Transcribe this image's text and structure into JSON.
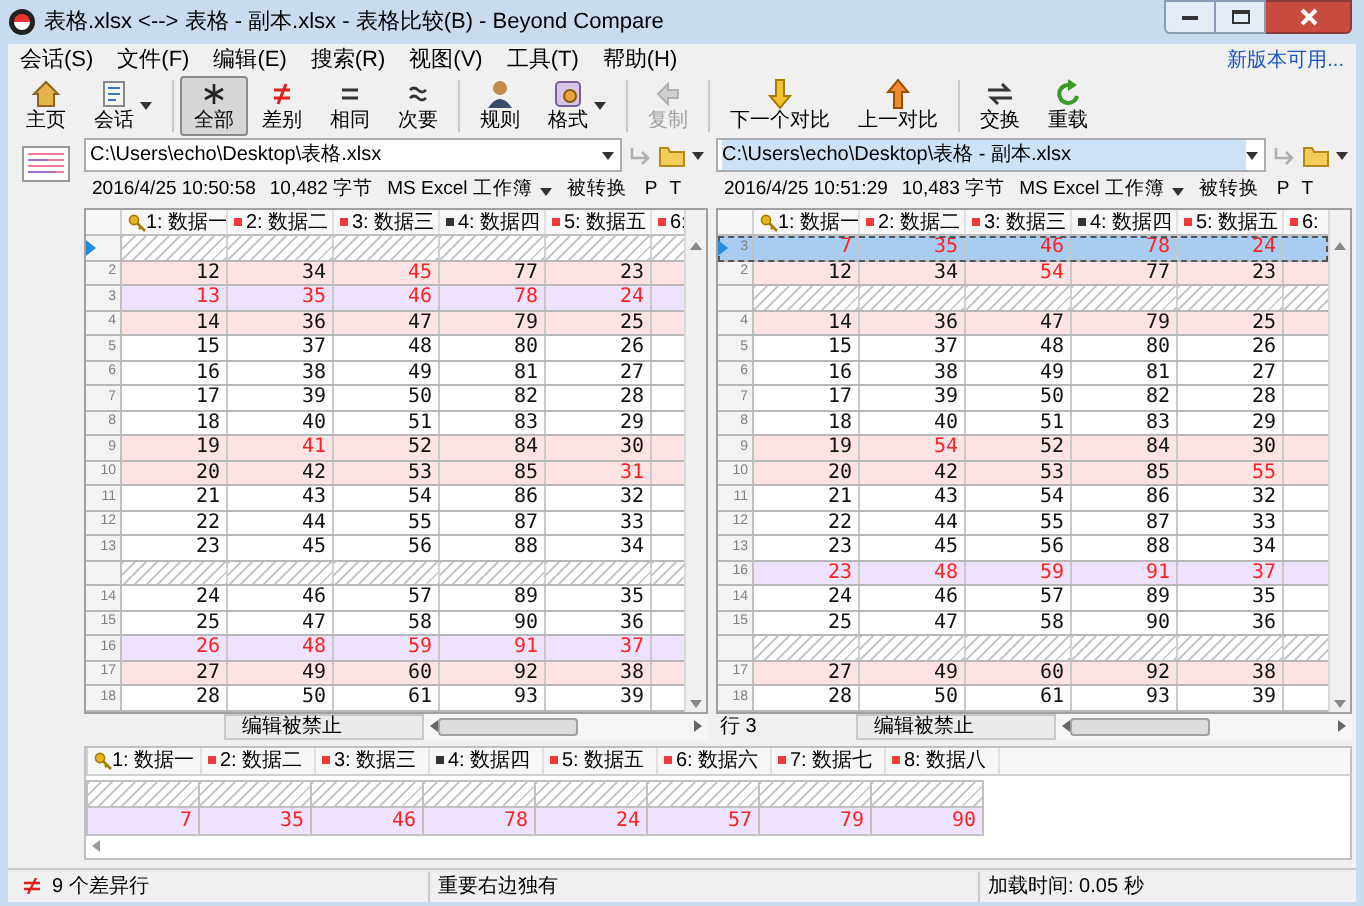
{
  "window": {
    "title": "表格.xlsx <--> 表格 - 副本.xlsx - 表格比较(B) - Beyond Compare"
  },
  "menu": [
    "会话(S)",
    "文件(F)",
    "编辑(E)",
    "搜索(R)",
    "视图(V)",
    "工具(T)",
    "帮助(H)"
  ],
  "update_link": "新版本可用...",
  "toolbar": [
    [
      {
        "label": "主页",
        "kind": "home",
        "selected": false,
        "disabled": false,
        "dropdown": false
      },
      {
        "label": "会话",
        "kind": "session",
        "selected": false,
        "disabled": false,
        "dropdown": true
      }
    ],
    [
      {
        "label": "全部",
        "kind": "all",
        "selected": true,
        "disabled": false,
        "dropdown": false
      },
      {
        "label": "差别",
        "kind": "diffs",
        "selected": false,
        "disabled": false,
        "dropdown": false
      },
      {
        "label": "相同",
        "kind": "same",
        "selected": false,
        "disabled": false,
        "dropdown": false
      },
      {
        "label": "次要",
        "kind": "minor",
        "selected": false,
        "disabled": false,
        "dropdown": false
      }
    ],
    [
      {
        "label": "规则",
        "kind": "rules",
        "selected": false,
        "disabled": false,
        "dropdown": false
      },
      {
        "label": "格式",
        "kind": "format",
        "selected": false,
        "disabled": false,
        "dropdown": true
      }
    ],
    [
      {
        "label": "复制",
        "kind": "copy",
        "selected": false,
        "disabled": true,
        "dropdown": false
      }
    ],
    [
      {
        "label": "下一个对比",
        "kind": "next",
        "selected": false,
        "disabled": false,
        "dropdown": false
      },
      {
        "label": "上一对比",
        "kind": "prev",
        "selected": false,
        "disabled": false,
        "dropdown": false
      }
    ],
    [
      {
        "label": "交换",
        "kind": "swap",
        "selected": false,
        "disabled": false,
        "dropdown": false
      },
      {
        "label": "重载",
        "kind": "reload",
        "selected": false,
        "disabled": false,
        "dropdown": false
      }
    ]
  ],
  "panes": [
    {
      "path": "C:\\Users\\echo\\Desktop\\表格.xlsx",
      "path_selected": false,
      "modified": "2016/4/25 10:50:58",
      "size": "10,482 字节",
      "format": "MS Excel 工作簿",
      "converted": "被转换",
      "flags": [
        "P",
        "T"
      ],
      "columns": [
        {
          "label": "1: 数据一",
          "kind": "key"
        },
        {
          "label": "2: 数据二",
          "kind": "red"
        },
        {
          "label": "3: 数据三",
          "kind": "red"
        },
        {
          "label": "4: 数据四",
          "kind": "black"
        },
        {
          "label": "5: 数据五",
          "kind": "red"
        },
        {
          "label": "6:",
          "kind": "red"
        }
      ],
      "rows": [
        {
          "kind": "gap",
          "current": true
        },
        {
          "kind": "diff",
          "number": "2",
          "selected": false,
          "current": false,
          "cells": [
            {
              "text": "12",
              "diff": false
            },
            {
              "text": "34",
              "diff": false
            },
            {
              "text": "45",
              "diff": true
            },
            {
              "text": "77",
              "diff": false
            },
            {
              "text": "23",
              "diff": false
            }
          ]
        },
        {
          "kind": "orphan",
          "number": "3",
          "selected": false,
          "current": false,
          "cells": [
            {
              "text": "13",
              "diff": true
            },
            {
              "text": "35",
              "diff": true
            },
            {
              "text": "46",
              "diff": true
            },
            {
              "text": "78",
              "diff": true
            },
            {
              "text": "24",
              "diff": true
            }
          ]
        },
        {
          "kind": "diff",
          "number": "4",
          "selected": false,
          "current": false,
          "cells": [
            {
              "text": "14",
              "diff": false
            },
            {
              "text": "36",
              "diff": false
            },
            {
              "text": "47",
              "diff": false
            },
            {
              "text": "79",
              "diff": false
            },
            {
              "text": "25",
              "diff": false
            }
          ]
        },
        {
          "kind": "same",
          "number": "5",
          "selected": false,
          "current": false,
          "cells": [
            {
              "text": "15",
              "diff": false
            },
            {
              "text": "37",
              "diff": false
            },
            {
              "text": "48",
              "diff": false
            },
            {
              "text": "80",
              "diff": false
            },
            {
              "text": "26",
              "diff": false
            }
          ]
        },
        {
          "kind": "same",
          "number": "6",
          "selected": false,
          "current": false,
          "cells": [
            {
              "text": "16",
              "diff": false
            },
            {
              "text": "38",
              "diff": false
            },
            {
              "text": "49",
              "diff": false
            },
            {
              "text": "81",
              "diff": false
            },
            {
              "text": "27",
              "diff": false
            }
          ]
        },
        {
          "kind": "same",
          "number": "7",
          "selected": false,
          "current": false,
          "cells": [
            {
              "text": "17",
              "diff": false
            },
            {
              "text": "39",
              "diff": false
            },
            {
              "text": "50",
              "diff": false
            },
            {
              "text": "82",
              "diff": false
            },
            {
              "text": "28",
              "diff": false
            }
          ]
        },
        {
          "kind": "same",
          "number": "8",
          "selected": false,
          "current": false,
          "cells": [
            {
              "text": "18",
              "diff": false
            },
            {
              "text": "40",
              "diff": false
            },
            {
              "text": "51",
              "diff": false
            },
            {
              "text": "83",
              "diff": false
            },
            {
              "text": "29",
              "diff": false
            }
          ]
        },
        {
          "kind": "diff",
          "number": "9",
          "selected": false,
          "current": false,
          "cells": [
            {
              "text": "19",
              "diff": false
            },
            {
              "text": "41",
              "diff": true
            },
            {
              "text": "52",
              "diff": false
            },
            {
              "text": "84",
              "diff": false
            },
            {
              "text": "30",
              "diff": false
            }
          ]
        },
        {
          "kind": "diff",
          "number": "10",
          "selected": false,
          "current": false,
          "cells": [
            {
              "text": "20",
              "diff": false
            },
            {
              "text": "42",
              "diff": false
            },
            {
              "text": "53",
              "diff": false
            },
            {
              "text": "85",
              "diff": false
            },
            {
              "text": "31",
              "diff": true
            }
          ]
        },
        {
          "kind": "same",
          "number": "11",
          "selected": false,
          "current": false,
          "cells": [
            {
              "text": "21",
              "diff": false
            },
            {
              "text": "43",
              "diff": false
            },
            {
              "text": "54",
              "diff": false
            },
            {
              "text": "86",
              "diff": false
            },
            {
              "text": "32",
              "diff": false
            }
          ]
        },
        {
          "kind": "same",
          "number": "12",
          "selected": false,
          "current": false,
          "cells": [
            {
              "text": "22",
              "diff": false
            },
            {
              "text": "44",
              "diff": false
            },
            {
              "text": "55",
              "diff": false
            },
            {
              "text": "87",
              "diff": false
            },
            {
              "text": "33",
              "diff": false
            }
          ]
        },
        {
          "kind": "same",
          "number": "13",
          "selected": false,
          "current": false,
          "cells": [
            {
              "text": "23",
              "diff": false
            },
            {
              "text": "45",
              "diff": false
            },
            {
              "text": "56",
              "diff": false
            },
            {
              "text": "88",
              "diff": false
            },
            {
              "text": "34",
              "diff": false
            }
          ]
        },
        {
          "kind": "gap",
          "current": false
        },
        {
          "kind": "same",
          "number": "14",
          "selected": false,
          "current": false,
          "cells": [
            {
              "text": "24",
              "diff": false
            },
            {
              "text": "46",
              "diff": false
            },
            {
              "text": "57",
              "diff": false
            },
            {
              "text": "89",
              "diff": false
            },
            {
              "text": "35",
              "diff": false
            }
          ]
        },
        {
          "kind": "same",
          "number": "15",
          "selected": false,
          "current": false,
          "cells": [
            {
              "text": "25",
              "diff": false
            },
            {
              "text": "47",
              "diff": false
            },
            {
              "text": "58",
              "diff": false
            },
            {
              "text": "90",
              "diff": false
            },
            {
              "text": "36",
              "diff": false
            }
          ]
        },
        {
          "kind": "orphan",
          "number": "16",
          "selected": false,
          "current": false,
          "cells": [
            {
              "text": "26",
              "diff": true
            },
            {
              "text": "48",
              "diff": true
            },
            {
              "text": "59",
              "diff": true
            },
            {
              "text": "91",
              "diff": true
            },
            {
              "text": "37",
              "diff": true
            }
          ]
        },
        {
          "kind": "diff",
          "number": "17",
          "selected": false,
          "current": false,
          "cells": [
            {
              "text": "27",
              "diff": false
            },
            {
              "text": "49",
              "diff": false
            },
            {
              "text": "60",
              "diff": false
            },
            {
              "text": "92",
              "diff": false
            },
            {
              "text": "38",
              "diff": false
            }
          ]
        },
        {
          "kind": "same",
          "number": "18",
          "selected": false,
          "current": false,
          "cells": [
            {
              "text": "28",
              "diff": false
            },
            {
              "text": "50",
              "diff": false
            },
            {
              "text": "61",
              "diff": false
            },
            {
              "text": "93",
              "diff": false
            },
            {
              "text": "39",
              "diff": false
            }
          ]
        }
      ],
      "edit_status": "编辑被禁止"
    },
    {
      "path": "C:\\Users\\echo\\Desktop\\表格 - 副本.xlsx",
      "path_selected": true,
      "modified": "2016/4/25 10:51:29",
      "size": "10,483 字节",
      "format": "MS Excel 工作簿",
      "converted": "被转换",
      "flags": [
        "P",
        "T"
      ],
      "columns": [
        {
          "label": "1: 数据一",
          "kind": "key"
        },
        {
          "label": "2: 数据二",
          "kind": "red"
        },
        {
          "label": "3: 数据三",
          "kind": "red"
        },
        {
          "label": "4: 数据四",
          "kind": "black"
        },
        {
          "label": "5: 数据五",
          "kind": "red"
        },
        {
          "label": "6:",
          "kind": "red"
        }
      ],
      "rows": [
        {
          "kind": "orphan",
          "number": "3",
          "selected": true,
          "current": true,
          "cells": [
            {
              "text": "7",
              "diff": true
            },
            {
              "text": "35",
              "diff": true
            },
            {
              "text": "46",
              "diff": true
            },
            {
              "text": "78",
              "diff": true
            },
            {
              "text": "24",
              "diff": true
            }
          ]
        },
        {
          "kind": "diff",
          "number": "2",
          "selected": false,
          "current": false,
          "cells": [
            {
              "text": "12",
              "diff": false
            },
            {
              "text": "34",
              "diff": false
            },
            {
              "text": "54",
              "diff": true
            },
            {
              "text": "77",
              "diff": false
            },
            {
              "text": "23",
              "diff": false
            }
          ]
        },
        {
          "kind": "gap",
          "current": false
        },
        {
          "kind": "diff",
          "number": "4",
          "selected": false,
          "current": false,
          "cells": [
            {
              "text": "14",
              "diff": false
            },
            {
              "text": "36",
              "diff": false
            },
            {
              "text": "47",
              "diff": false
            },
            {
              "text": "79",
              "diff": false
            },
            {
              "text": "25",
              "diff": false
            }
          ]
        },
        {
          "kind": "same",
          "number": "5",
          "selected": false,
          "current": false,
          "cells": [
            {
              "text": "15",
              "diff": false
            },
            {
              "text": "37",
              "diff": false
            },
            {
              "text": "48",
              "diff": false
            },
            {
              "text": "80",
              "diff": false
            },
            {
              "text": "26",
              "diff": false
            }
          ]
        },
        {
          "kind": "same",
          "number": "6",
          "selected": false,
          "current": false,
          "cells": [
            {
              "text": "16",
              "diff": false
            },
            {
              "text": "38",
              "diff": false
            },
            {
              "text": "49",
              "diff": false
            },
            {
              "text": "81",
              "diff": false
            },
            {
              "text": "27",
              "diff": false
            }
          ]
        },
        {
          "kind": "same",
          "number": "7",
          "selected": false,
          "current": false,
          "cells": [
            {
              "text": "17",
              "diff": false
            },
            {
              "text": "39",
              "diff": false
            },
            {
              "text": "50",
              "diff": false
            },
            {
              "text": "82",
              "diff": false
            },
            {
              "text": "28",
              "diff": false
            }
          ]
        },
        {
          "kind": "same",
          "number": "8",
          "selected": false,
          "current": false,
          "cells": [
            {
              "text": "18",
              "diff": false
            },
            {
              "text": "40",
              "diff": false
            },
            {
              "text": "51",
              "diff": false
            },
            {
              "text": "83",
              "diff": false
            },
            {
              "text": "29",
              "diff": false
            }
          ]
        },
        {
          "kind": "diff",
          "number": "9",
          "selected": false,
          "current": false,
          "cells": [
            {
              "text": "19",
              "diff": false
            },
            {
              "text": "54",
              "diff": true
            },
            {
              "text": "52",
              "diff": false
            },
            {
              "text": "84",
              "diff": false
            },
            {
              "text": "30",
              "diff": false
            }
          ]
        },
        {
          "kind": "diff",
          "number": "10",
          "selected": false,
          "current": false,
          "cells": [
            {
              "text": "20",
              "diff": false
            },
            {
              "text": "42",
              "diff": false
            },
            {
              "text": "53",
              "diff": false
            },
            {
              "text": "85",
              "diff": false
            },
            {
              "text": "55",
              "diff": true
            }
          ]
        },
        {
          "kind": "same",
          "number": "11",
          "selected": false,
          "current": false,
          "cells": [
            {
              "text": "21",
              "diff": false
            },
            {
              "text": "43",
              "diff": false
            },
            {
              "text": "54",
              "diff": false
            },
            {
              "text": "86",
              "diff": false
            },
            {
              "text": "32",
              "diff": false
            }
          ]
        },
        {
          "kind": "same",
          "number": "12",
          "selected": false,
          "current": false,
          "cells": [
            {
              "text": "22",
              "diff": false
            },
            {
              "text": "44",
              "diff": false
            },
            {
              "text": "55",
              "diff": false
            },
            {
              "text": "87",
              "diff": false
            },
            {
              "text": "33",
              "diff": false
            }
          ]
        },
        {
          "kind": "same",
          "number": "13",
          "selected": false,
          "current": false,
          "cells": [
            {
              "text": "23",
              "diff": false
            },
            {
              "text": "45",
              "diff": false
            },
            {
              "text": "56",
              "diff": false
            },
            {
              "text": "88",
              "diff": false
            },
            {
              "text": "34",
              "diff": false
            }
          ]
        },
        {
          "kind": "orphan",
          "number": "16",
          "selected": false,
          "current": false,
          "cells": [
            {
              "text": "23",
              "diff": true
            },
            {
              "text": "48",
              "diff": true
            },
            {
              "text": "59",
              "diff": true
            },
            {
              "text": "91",
              "diff": true
            },
            {
              "text": "37",
              "diff": true
            }
          ]
        },
        {
          "kind": "same",
          "number": "14",
          "selected": false,
          "current": false,
          "cells": [
            {
              "text": "24",
              "diff": false
            },
            {
              "text": "46",
              "diff": false
            },
            {
              "text": "57",
              "diff": false
            },
            {
              "text": "89",
              "diff": false
            },
            {
              "text": "35",
              "diff": false
            }
          ]
        },
        {
          "kind": "same",
          "number": "15",
          "selected": false,
          "current": false,
          "cells": [
            {
              "text": "25",
              "diff": false
            },
            {
              "text": "47",
              "diff": false
            },
            {
              "text": "58",
              "diff": false
            },
            {
              "text": "90",
              "diff": false
            },
            {
              "text": "36",
              "diff": false
            }
          ]
        },
        {
          "kind": "gap",
          "current": false
        },
        {
          "kind": "diff",
          "number": "17",
          "selected": false,
          "current": false,
          "cells": [
            {
              "text": "27",
              "diff": false
            },
            {
              "text": "49",
              "diff": false
            },
            {
              "text": "60",
              "diff": false
            },
            {
              "text": "92",
              "diff": false
            },
            {
              "text": "38",
              "diff": false
            }
          ]
        },
        {
          "kind": "same",
          "number": "18",
          "selected": false,
          "current": false,
          "cells": [
            {
              "text": "28",
              "diff": false
            },
            {
              "text": "50",
              "diff": false
            },
            {
              "text": "61",
              "diff": false
            },
            {
              "text": "93",
              "diff": false
            },
            {
              "text": "39",
              "diff": false
            }
          ]
        }
      ],
      "position": "行 3",
      "edit_status": "编辑被禁止"
    }
  ],
  "detail": {
    "columns": [
      {
        "label": "1: 数据一",
        "kind": "key"
      },
      {
        "label": "2: 数据二",
        "kind": "red"
      },
      {
        "label": "3: 数据三",
        "kind": "red"
      },
      {
        "label": "4: 数据四",
        "kind": "black"
      },
      {
        "label": "5: 数据五",
        "kind": "red"
      },
      {
        "label": "6: 数据六",
        "kind": "red"
      },
      {
        "label": "7: 数据七",
        "kind": "red"
      },
      {
        "label": "8: 数据八",
        "kind": "red"
      }
    ],
    "rows": [
      {
        "kind": "gap"
      },
      {
        "kind": "orphan",
        "cells": [
          {
            "text": "7",
            "diff": true
          },
          {
            "text": "35",
            "diff": true
          },
          {
            "text": "46",
            "diff": true
          },
          {
            "text": "78",
            "diff": true
          },
          {
            "text": "24",
            "diff": true
          },
          {
            "text": "57",
            "diff": true
          },
          {
            "text": "79",
            "diff": true
          },
          {
            "text": "90",
            "diff": true
          }
        ]
      }
    ]
  },
  "status_bar": {
    "diff_count": "9 个差异行",
    "filter": "重要右边独有",
    "load_time": "加载时间: 0.05 秒"
  }
}
